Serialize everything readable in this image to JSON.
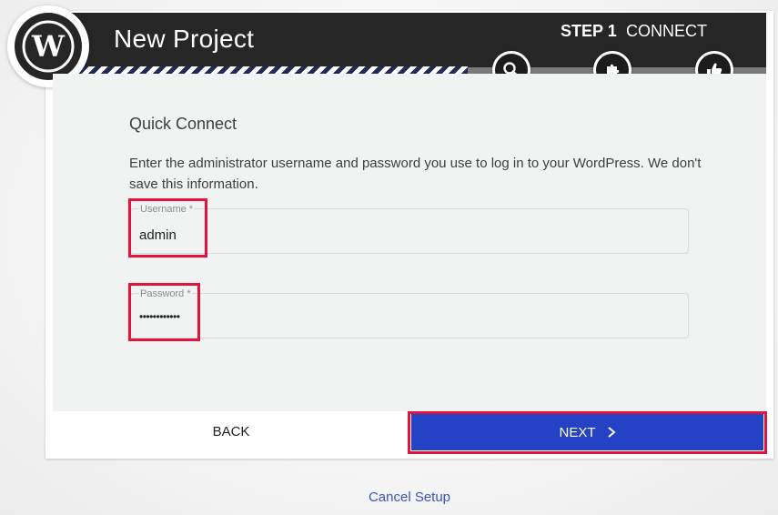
{
  "header": {
    "title": "New Project",
    "step_number": "STEP 1",
    "step_name": "CONNECT",
    "step_icons": [
      "search-icon",
      "puzzle-icon",
      "thumbs-up-icon"
    ],
    "logo": "wordpress-logo-icon"
  },
  "form": {
    "heading": "Quick Connect",
    "description": "Enter the administrator username and password you use to log in to your WordPress. We don't save this information.",
    "username": {
      "label": "Username *",
      "value": "admin"
    },
    "password": {
      "label": "Password *",
      "value": "••••••••••••"
    }
  },
  "actions": {
    "back_label": "BACK",
    "next_label": "NEXT",
    "cancel_label": "Cancel Setup"
  },
  "colors": {
    "header_bg": "#262626",
    "primary_button": "#2342c4",
    "link": "#3b54c4",
    "highlight": "#e4123f"
  }
}
